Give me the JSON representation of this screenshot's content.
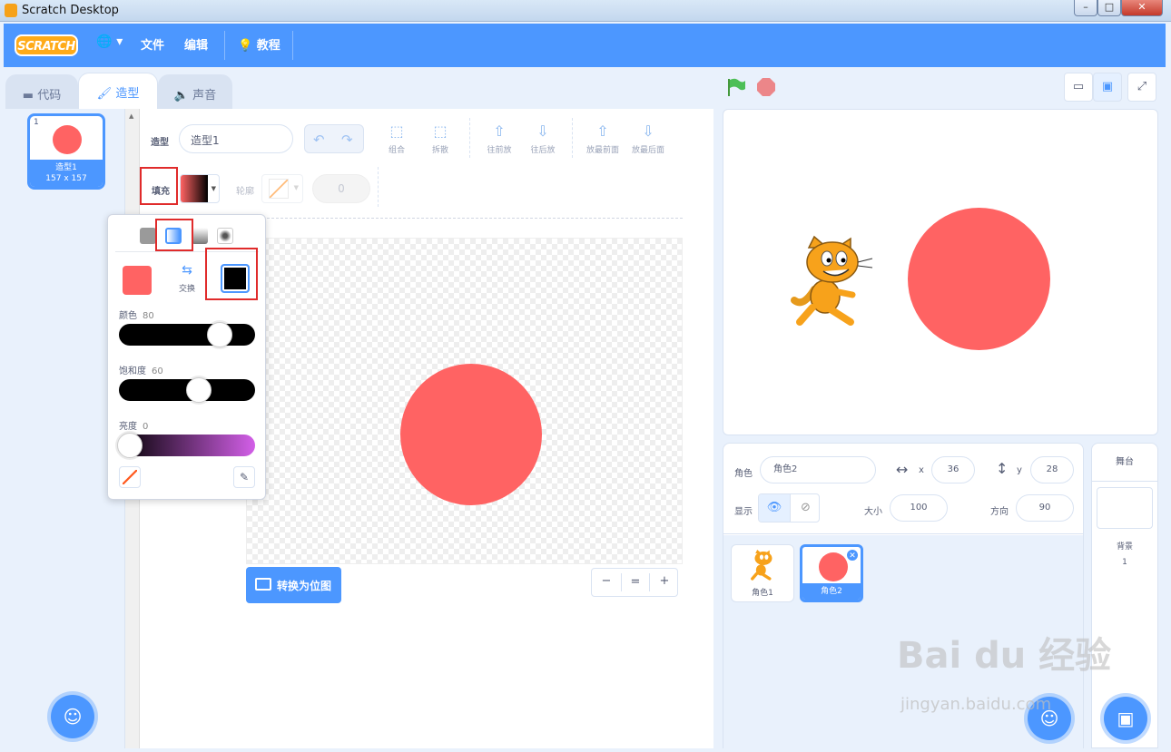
{
  "window": {
    "title": "Scratch Desktop",
    "minimize": "–",
    "maximize": "□",
    "close": "✕"
  },
  "menubar": {
    "logo": "SCRATCH",
    "globe": "🌐 ▾",
    "file": "文件",
    "edit": "编辑",
    "tutorials": "教程"
  },
  "tabs": {
    "code": "代码",
    "costumes": "造型",
    "sounds": "声音"
  },
  "costumes": [
    {
      "index": "1",
      "name": "造型1",
      "size": "157 x 157"
    }
  ],
  "paint_editor": {
    "costume_label": "造型",
    "costume_name": "造型1",
    "group": "组合",
    "ungroup": "拆散",
    "forward": "往前放",
    "backward": "往后放",
    "front": "放最前面",
    "back": "放最后面",
    "fill_label": "填充",
    "outline_label": "轮廓",
    "outline_width": "0",
    "convert_button": "转换为位图",
    "zoom_out": "−",
    "zoom_reset": "=",
    "zoom_in": "+",
    "fill_color": "#ff6363"
  },
  "color_picker": {
    "swap_label": "交换",
    "hue_label": "颜色",
    "hue_value": "80",
    "saturation_label": "饱和度",
    "saturation_value": "60",
    "brightness_label": "亮度",
    "brightness_value": "0",
    "hue_level": 0.8,
    "saturation_level": 0.6,
    "brightness_level": 0.0,
    "color1": "#ff6363",
    "color2": "#000000"
  },
  "sprite_info": {
    "sprite_label": "角色",
    "sprite_name": "角色2",
    "x_label": "x",
    "x_value": "36",
    "y_label": "y",
    "y_value": "28",
    "show_label": "显示",
    "size_label": "大小",
    "size_value": "100",
    "direction_label": "方向",
    "direction_value": "90"
  },
  "sprites": [
    {
      "name": "角色1"
    },
    {
      "name": "角色2",
      "selected": true
    }
  ],
  "stage_pane": {
    "title": "舞台",
    "backdrops_label": "背景",
    "backdrops_count": "1"
  },
  "watermark": {
    "main": "Bai du 经验",
    "sub": "jingyan.baidu.com"
  }
}
